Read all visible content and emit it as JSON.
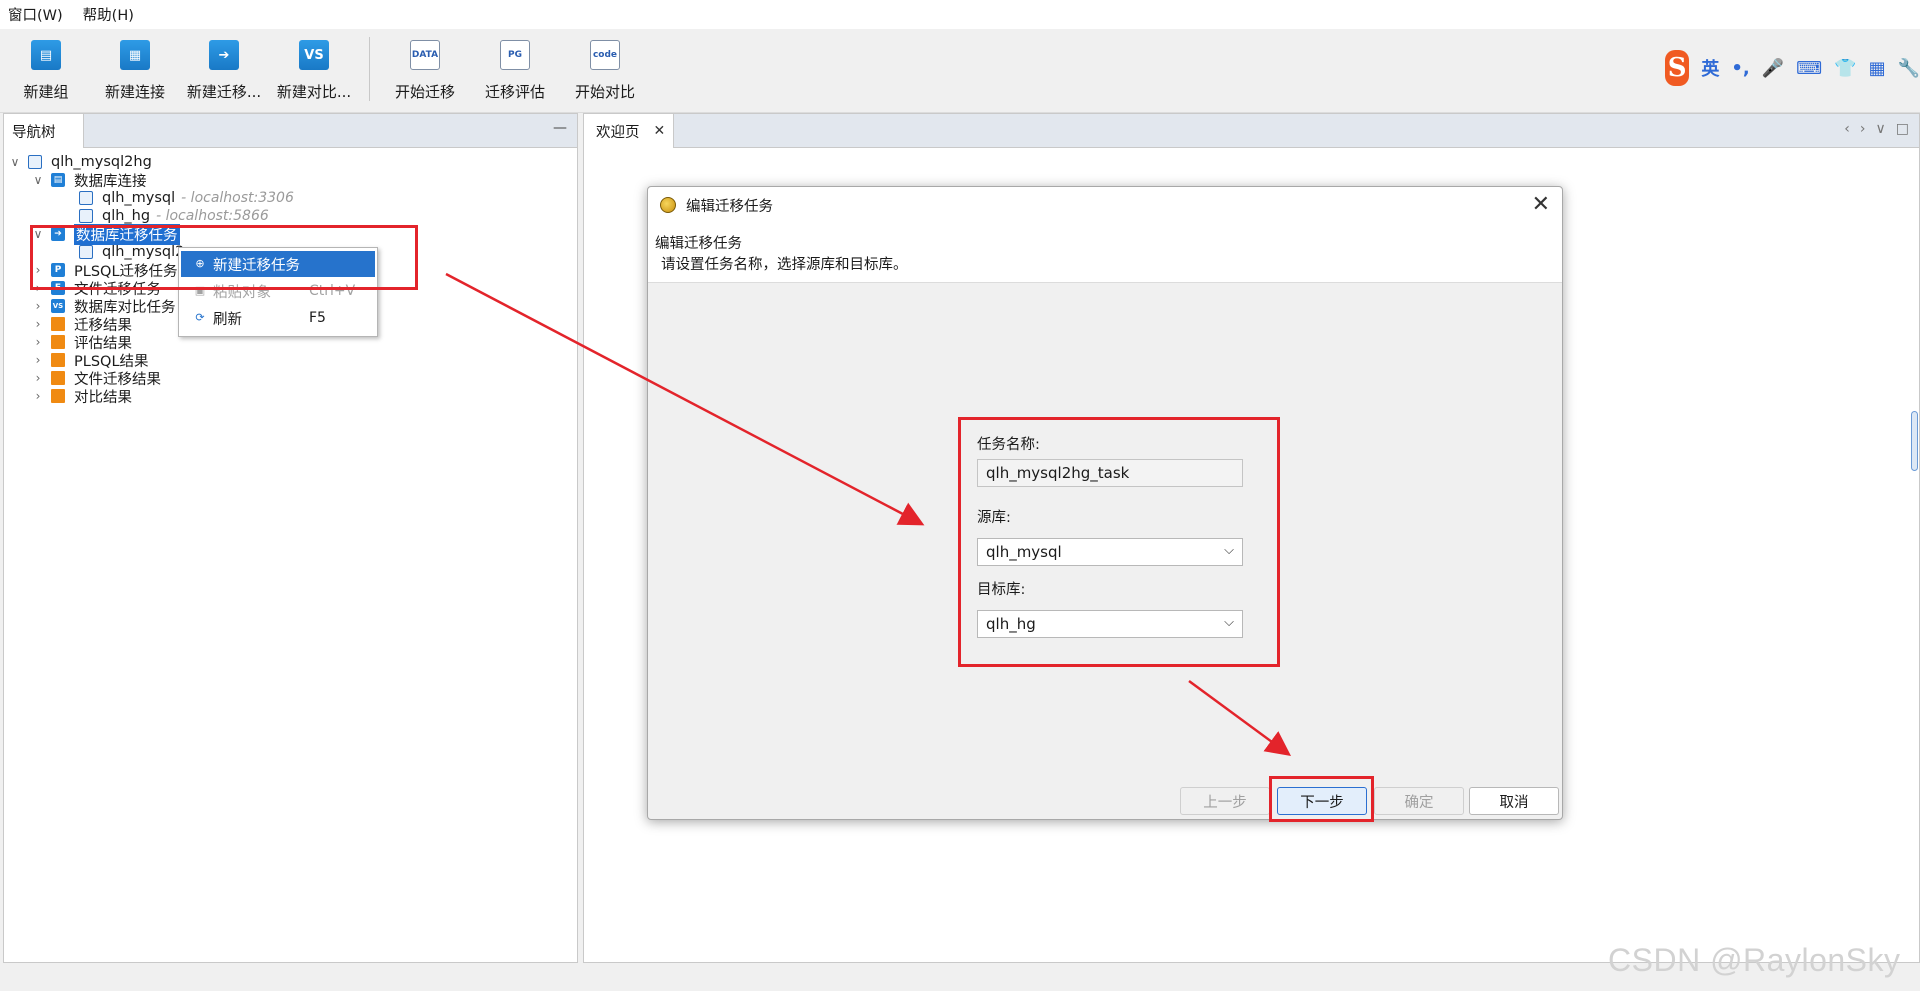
{
  "menu": {
    "items": [
      "窗口(W)",
      "帮助(H)"
    ]
  },
  "toolbar": {
    "buttons": [
      {
        "label": "新建组",
        "icon": "new-group-icon"
      },
      {
        "label": "新建连接",
        "icon": "new-connection-icon"
      },
      {
        "label": "新建迁移...",
        "icon": "new-migration-icon"
      },
      {
        "label": "新建对比...",
        "icon": "new-compare-icon",
        "icon_text": "VS"
      },
      {
        "label": "开始迁移",
        "icon": "start-migration-icon",
        "icon_text": "DATA"
      },
      {
        "label": "迁移评估",
        "icon": "migration-assess-icon",
        "icon_text": "PG"
      },
      {
        "label": "开始对比",
        "icon": "start-compare-icon",
        "icon_text": "code"
      }
    ]
  },
  "ime": {
    "logo": "S",
    "lang": "英",
    "items": [
      "•,",
      "🎤",
      "⌨",
      "👕",
      "▦",
      "🔧"
    ]
  },
  "nav": {
    "tab_label": "导航树",
    "minimize": "—",
    "tree": [
      {
        "label": "qlh_mysql2hg",
        "chev": "∨"
      },
      {
        "label": "数据库连接",
        "chev": "∨"
      },
      {
        "label": "qlh_mysql",
        "host": "- localhost:3306"
      },
      {
        "label": "qlh_hg",
        "host": "- localhost:5866"
      },
      {
        "label": "数据库迁移任务",
        "chev": "∨"
      },
      {
        "label": "qlh_mysql2"
      },
      {
        "label": "PLSQL迁移任务",
        "chev": "›"
      },
      {
        "label": "文件迁移任务",
        "chev": "›"
      },
      {
        "label": "数据库对比任务",
        "chev": "›"
      },
      {
        "label": "迁移结果",
        "chev": "›"
      },
      {
        "label": "评估结果",
        "chev": "›"
      },
      {
        "label": "PLSQL结果",
        "chev": "›"
      },
      {
        "label": "文件迁移结果",
        "chev": "›"
      },
      {
        "label": "对比结果",
        "chev": "›"
      }
    ]
  },
  "context_menu": {
    "items": [
      {
        "label": "新建迁移任务",
        "shortcut": ""
      },
      {
        "label": "粘贴对象",
        "shortcut": "Ctrl+V"
      },
      {
        "label": "刷新",
        "shortcut": "F5"
      }
    ]
  },
  "editor": {
    "tab_label": "欢迎页",
    "tab_close": "✕",
    "ctrls": [
      "‹",
      "›",
      "∨",
      "□"
    ]
  },
  "dialog": {
    "title": "编辑迁移任务",
    "close": "✕",
    "header_title": "编辑迁移任务",
    "header_desc": "请设置任务名称，选择源库和目标库。",
    "task_name_label": "任务名称:",
    "task_name_value": "qlh_mysql2hg_task",
    "source_label": "源库:",
    "source_value": "qlh_mysql",
    "target_label": "目标库:",
    "target_value": "qlh_hg",
    "buttons": {
      "prev": "上一步",
      "next": "下一步",
      "ok": "确定",
      "cancel": "取消"
    }
  },
  "watermark": "CSDN @RaylonSky",
  "colors": {
    "accent": "#1f6fd1",
    "annotation_red": "#e3242b",
    "folder_orange": "#f08a12"
  }
}
